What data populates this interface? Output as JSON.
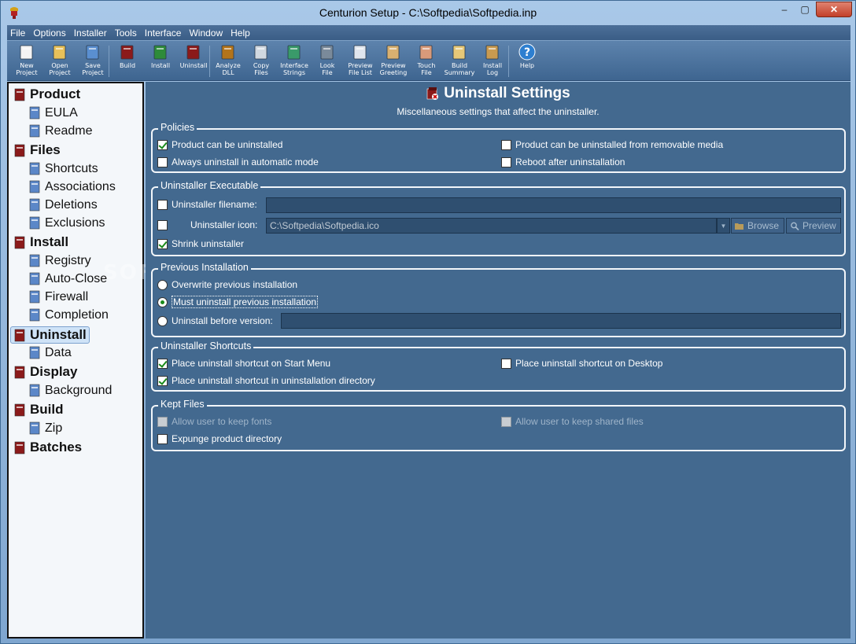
{
  "window": {
    "title": "Centurion Setup - C:\\Softpedia\\Softpedia.inp",
    "min": "–",
    "max": "▢",
    "close": "✕"
  },
  "menu": [
    "File",
    "Options",
    "Installer",
    "Tools",
    "Interface",
    "Window",
    "Help"
  ],
  "toolbar": [
    {
      "l1": "New",
      "l2": "Project",
      "icon": "new-project-icon"
    },
    {
      "l1": "Open",
      "l2": "Project",
      "icon": "open-project-icon"
    },
    {
      "l1": "Save",
      "l2": "Project",
      "icon": "save-project-icon"
    },
    {
      "l1": "Build",
      "l2": "",
      "icon": "build-icon"
    },
    {
      "l1": "Install",
      "l2": "",
      "icon": "install-icon"
    },
    {
      "l1": "Uninstall",
      "l2": "",
      "icon": "uninstall-icon"
    },
    {
      "l1": "Analyze",
      "l2": "DLL",
      "icon": "analyze-dll-icon"
    },
    {
      "l1": "Copy",
      "l2": "Files",
      "icon": "copy-files-icon"
    },
    {
      "l1": "Interface",
      "l2": "Strings",
      "icon": "interface-strings-icon"
    },
    {
      "l1": "Look",
      "l2": "File",
      "icon": "look-file-icon"
    },
    {
      "l1": "Preview",
      "l2": "File List",
      "icon": "preview-file-list-icon"
    },
    {
      "l1": "Preview",
      "l2": "Greeting",
      "icon": "preview-greeting-icon"
    },
    {
      "l1": "Touch",
      "l2": "File",
      "icon": "touch-file-icon"
    },
    {
      "l1": "Build",
      "l2": "Summary",
      "icon": "build-summary-icon"
    },
    {
      "l1": "Install",
      "l2": "Log",
      "icon": "install-log-icon"
    },
    {
      "l1": "Help",
      "l2": "",
      "icon": "help-icon"
    }
  ],
  "tree": [
    {
      "label": "Product",
      "level": "top",
      "icon": "product-icon"
    },
    {
      "label": "EULA",
      "level": "child",
      "icon": "eula-icon"
    },
    {
      "label": "Readme",
      "level": "child",
      "icon": "readme-icon"
    },
    {
      "label": "Files",
      "level": "top",
      "icon": "files-icon"
    },
    {
      "label": "Shortcuts",
      "level": "child",
      "icon": "shortcuts-icon"
    },
    {
      "label": "Associations",
      "level": "child",
      "icon": "associations-icon"
    },
    {
      "label": "Deletions",
      "level": "child",
      "icon": "deletions-icon"
    },
    {
      "label": "Exclusions",
      "level": "child",
      "icon": "exclusions-icon"
    },
    {
      "label": "Install",
      "level": "top",
      "icon": "install-node-icon"
    },
    {
      "label": "Registry",
      "level": "child",
      "icon": "registry-icon"
    },
    {
      "label": "Auto-Close",
      "level": "child",
      "icon": "auto-close-icon"
    },
    {
      "label": "Firewall",
      "level": "child",
      "icon": "firewall-icon"
    },
    {
      "label": "Completion",
      "level": "child",
      "icon": "completion-icon"
    },
    {
      "label": "Uninstall",
      "level": "top",
      "icon": "uninstall-node-icon",
      "selected": true
    },
    {
      "label": "Data",
      "level": "child",
      "icon": "data-icon"
    },
    {
      "label": "Display",
      "level": "top",
      "icon": "display-icon"
    },
    {
      "label": "Background",
      "level": "child",
      "icon": "background-icon"
    },
    {
      "label": "Build",
      "level": "top",
      "icon": "build-node-icon"
    },
    {
      "label": "Zip",
      "level": "child",
      "icon": "zip-icon"
    },
    {
      "label": "Batches",
      "level": "top",
      "icon": "batches-icon"
    }
  ],
  "watermark": "SOFTPEDIA",
  "header": {
    "title": "Uninstall Settings",
    "subtitle": "Miscellaneous settings that affect the uninstaller."
  },
  "policies": {
    "legend": "Policies",
    "product_uninstalled": {
      "label": "Product can be uninstalled",
      "checked": true
    },
    "removable_media": {
      "label": "Product can be uninstalled from removable media",
      "checked": false
    },
    "automatic_mode": {
      "label": "Always uninstall in automatic mode",
      "checked": false
    },
    "reboot": {
      "label": "Reboot after uninstallation",
      "checked": false
    }
  },
  "executable": {
    "legend": "Uninstaller Executable",
    "filename_label": "Uninstaller filename:",
    "filename_value": "",
    "icon_label": "Uninstaller icon:",
    "icon_value": "C:\\Softpedia\\Softpedia.ico",
    "browse": "Browse",
    "preview": "Preview",
    "shrink": {
      "label": "Shrink uninstaller",
      "checked": true
    }
  },
  "previous": {
    "legend": "Previous Installation",
    "overwrite": "Overwrite previous installation",
    "must_uninstall": "Must uninstall previous installation",
    "before_version": "Uninstall before version:",
    "selected": "must_uninstall",
    "version_value": ""
  },
  "shortcuts": {
    "legend": "Uninstaller Shortcuts",
    "start_menu": {
      "label": "Place uninstall shortcut on Start Menu",
      "checked": true
    },
    "desktop": {
      "label": "Place uninstall shortcut on Desktop",
      "checked": false
    },
    "install_dir": {
      "label": "Place uninstall shortcut in uninstallation directory",
      "checked": true
    }
  },
  "kept": {
    "legend": "Kept Files",
    "keep_fonts": {
      "label": "Allow user to keep fonts",
      "checked": false,
      "disabled": true
    },
    "keep_shared": {
      "label": "Allow user to keep shared files",
      "checked": false,
      "disabled": true
    },
    "expunge": {
      "label": "Expunge product directory",
      "checked": false
    }
  }
}
